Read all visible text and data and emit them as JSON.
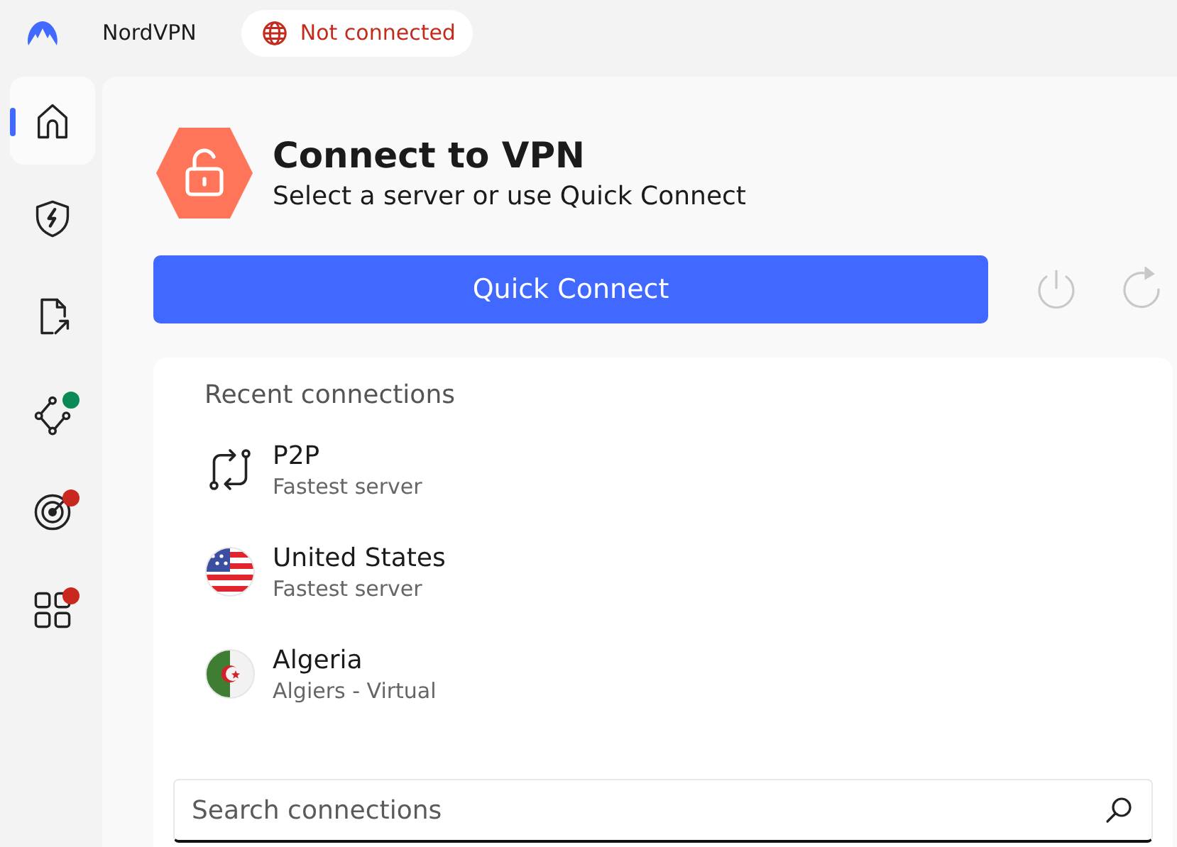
{
  "app": {
    "name": "NordVPN"
  },
  "status": {
    "text": "Not connected",
    "connected": false
  },
  "sidebar": {
    "items": [
      {
        "kind": "home",
        "selected": true
      },
      {
        "kind": "shield",
        "selected": false
      },
      {
        "kind": "file",
        "selected": false
      },
      {
        "kind": "mesh",
        "selected": false,
        "color": "#0b8a55"
      },
      {
        "kind": "target",
        "selected": false,
        "color": "#c8281e"
      },
      {
        "kind": "apps",
        "selected": false,
        "color": "#c8281e"
      }
    ]
  },
  "header": {
    "title": "Connect to VPN",
    "subtitle": "Select a server or use Quick Connect",
    "connected": false
  },
  "quick_connect": {
    "label": "Quick Connect"
  },
  "recent": {
    "title": "Recent connections",
    "items": [
      {
        "kind": "p2p",
        "name": "P2P",
        "detail": "Fastest server"
      },
      {
        "kind": "us",
        "name": "United States",
        "detail": "Fastest server"
      },
      {
        "kind": "dz",
        "name": "Algeria",
        "detail": "Algiers - Virtual"
      }
    ]
  },
  "search": {
    "placeholder": "Search connections"
  }
}
